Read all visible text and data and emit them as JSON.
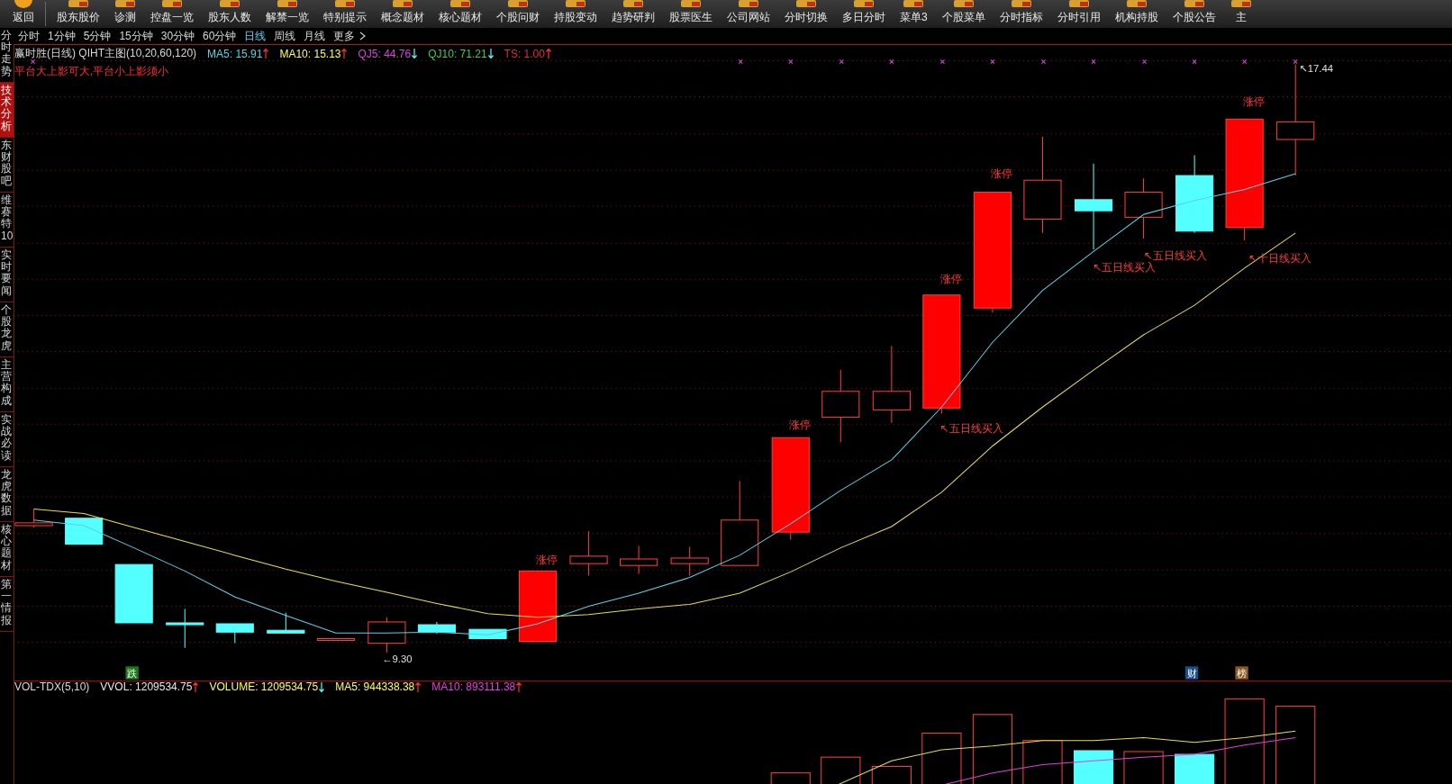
{
  "toolbar": {
    "items": [
      {
        "label": "返回",
        "kind": "back"
      },
      {
        "label": "股东股价",
        "kind": "tool"
      },
      {
        "label": "诊测",
        "kind": "tool"
      },
      {
        "label": "控盘一览",
        "kind": "tool"
      },
      {
        "label": "股东人数",
        "kind": "tool"
      },
      {
        "label": "解禁一览",
        "kind": "tool"
      },
      {
        "label": "特别提示",
        "kind": "tool"
      },
      {
        "label": "概念题材",
        "kind": "tool"
      },
      {
        "label": "核心题材",
        "kind": "tool"
      },
      {
        "label": "个股问财",
        "kind": "tool"
      },
      {
        "label": "持股变动",
        "kind": "tool"
      },
      {
        "label": "趋势研判",
        "kind": "tool"
      },
      {
        "label": "股票医生",
        "kind": "tool"
      },
      {
        "label": "公司网站",
        "kind": "tool"
      },
      {
        "label": "分时切换",
        "kind": "tool"
      },
      {
        "label": "多日分时",
        "kind": "tool"
      },
      {
        "label": "菜单3",
        "kind": "tool"
      },
      {
        "label": "个股菜单",
        "kind": "tool"
      },
      {
        "label": "分时指标",
        "kind": "tool"
      },
      {
        "label": "分时引用",
        "kind": "tool"
      },
      {
        "label": "机构持股",
        "kind": "tool"
      },
      {
        "label": "个股公告",
        "kind": "tool"
      },
      {
        "label": "主",
        "kind": "tool"
      }
    ]
  },
  "period_tabs": [
    {
      "label": "分时",
      "selected": false
    },
    {
      "label": "1分钟",
      "selected": false
    },
    {
      "label": "5分钟",
      "selected": false
    },
    {
      "label": "15分钟",
      "selected": false
    },
    {
      "label": "30分钟",
      "selected": false
    },
    {
      "label": "60分钟",
      "selected": false
    },
    {
      "label": "日线",
      "selected": true
    },
    {
      "label": "周线",
      "selected": false
    },
    {
      "label": "月线",
      "selected": false
    },
    {
      "label": "更多",
      "selected": false
    }
  ],
  "sidebar": {
    "items": [
      {
        "label": "分时走势",
        "selected": false
      },
      {
        "label": "技术分析",
        "selected": true
      },
      {
        "label": "东财股吧",
        "selected": false
      },
      {
        "label": "维赛特10",
        "selected": false
      },
      {
        "label": "实时要闻",
        "selected": false
      },
      {
        "label": "个股龙虎",
        "selected": false
      },
      {
        "label": "主营构成",
        "selected": false
      },
      {
        "label": "实战必读",
        "selected": false
      },
      {
        "label": "龙虎数据",
        "selected": false
      },
      {
        "label": "核心题材",
        "selected": false
      },
      {
        "label": "第一情报",
        "selected": false
      }
    ]
  },
  "chart": {
    "title": "赢时胜(日线) QIHT主图(10,20,60,120)",
    "indicators": [
      {
        "label": "MA5: 15.91",
        "rising": true,
        "color": "#55d4e8"
      },
      {
        "label": "MA10: 15.13",
        "rising": true,
        "color": "#ffff55"
      },
      {
        "label": "QJ5: 44.76",
        "rising": false,
        "color": "#e040e0"
      },
      {
        "label": "QJ10: 71.21",
        "rising": false,
        "color": "#40d040"
      },
      {
        "label": "TS: 1.00",
        "rising": true,
        "color": "#e03030"
      }
    ],
    "note": "平台大上影可大,平台小上影须小",
    "annotations": [
      {
        "kind": "limit_up",
        "text": "涨停"
      },
      {
        "kind": "limit_up",
        "text": "涨停"
      },
      {
        "kind": "limit_up",
        "text": "涨停"
      },
      {
        "kind": "limit_up",
        "text": "涨停"
      },
      {
        "kind": "limit_up",
        "text": "涨停"
      },
      {
        "kind": "buy",
        "text": "↖五日线买入"
      },
      {
        "kind": "buy",
        "text": "↖五日线买入"
      },
      {
        "kind": "buy",
        "text": "↖五日线买入"
      },
      {
        "kind": "buy",
        "text": "↖十日线买入"
      }
    ],
    "price_labels": [
      {
        "text": "←9.30"
      },
      {
        "text": "↖17.44"
      }
    ],
    "markers": [
      {
        "text": "跌",
        "color": "#1c7a1c"
      },
      {
        "text": "财",
        "color": "#1c4f8a"
      },
      {
        "text": "榜",
        "color": "#8a5a20"
      }
    ]
  },
  "volume": {
    "title": "VOL-TDX(5,10)",
    "indicators": [
      {
        "label": "VVOL: 1209534.75",
        "rising": true,
        "color": "#e8e8e8"
      },
      {
        "label": "VOLUME: 1209534.75",
        "rising": false,
        "color": "#ffff55"
      },
      {
        "label": "MA5: 944338.38",
        "rising": true,
        "color": "#ffff55"
      },
      {
        "label": "MA10: 893111.38",
        "rising": true,
        "color": "#e040e0"
      }
    ]
  }
}
